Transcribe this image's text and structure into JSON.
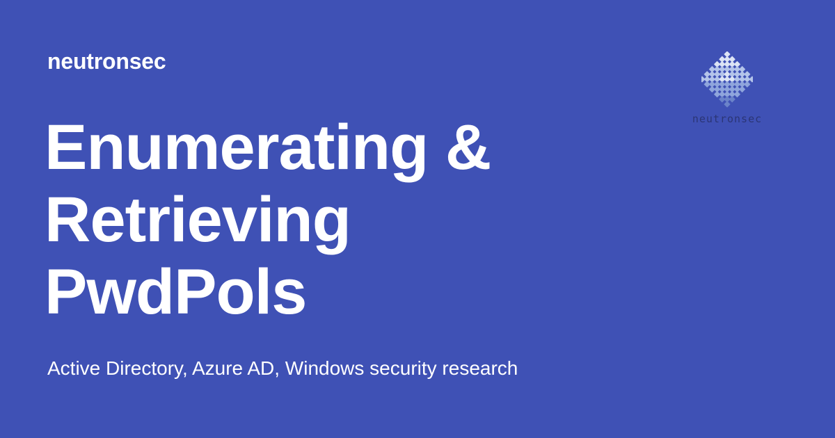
{
  "site": {
    "name": "neutronsec"
  },
  "title": {
    "lines": [
      "Enumerating &",
      "Retrieving",
      "PwdPols"
    ]
  },
  "description": "Active Directory, Azure AD, Windows security research",
  "logo": {
    "wordmark": "neutronsec",
    "tile_colors": [
      "#dce4f5",
      "#b4c4ea",
      "#8fa5dc",
      "#6b83c9"
    ]
  },
  "colors": {
    "background": "#3f51b5",
    "text": "#ffffff"
  }
}
